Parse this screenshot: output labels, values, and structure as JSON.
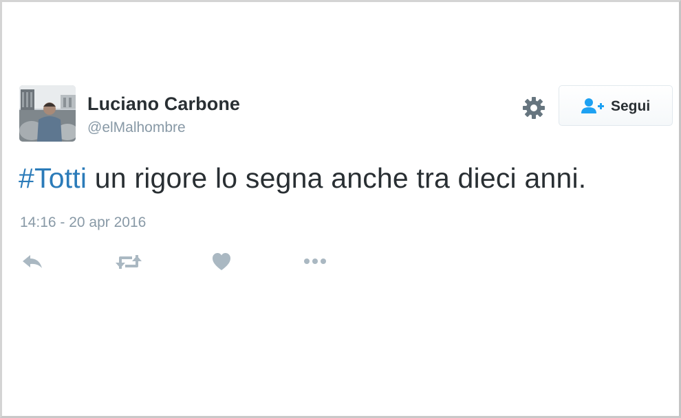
{
  "tweet": {
    "author": {
      "display_name": "Luciano Carbone",
      "handle": "@elMalhombre",
      "avatar_icon": "avatar-photo"
    },
    "text": {
      "hashtag": "#Totti",
      "body": " un rigore lo segna anche tra dieci anni."
    },
    "timestamp": "14:16 - 20 apr 2016",
    "follow_button": {
      "label": "Segui",
      "icon": "follow-user-icon"
    },
    "settings_icon": "gear-icon",
    "actions": [
      {
        "name": "reply",
        "icon": "reply-icon"
      },
      {
        "name": "retweet",
        "icon": "retweet-icon"
      },
      {
        "name": "like",
        "icon": "heart-icon"
      },
      {
        "name": "more",
        "icon": "more-icon"
      }
    ]
  },
  "colors": {
    "text": "#292f33",
    "muted": "#8899a6",
    "hashtag": "#2b7bb9",
    "follow_icon": "#1da1f2",
    "action_icon": "#aab8c2"
  }
}
